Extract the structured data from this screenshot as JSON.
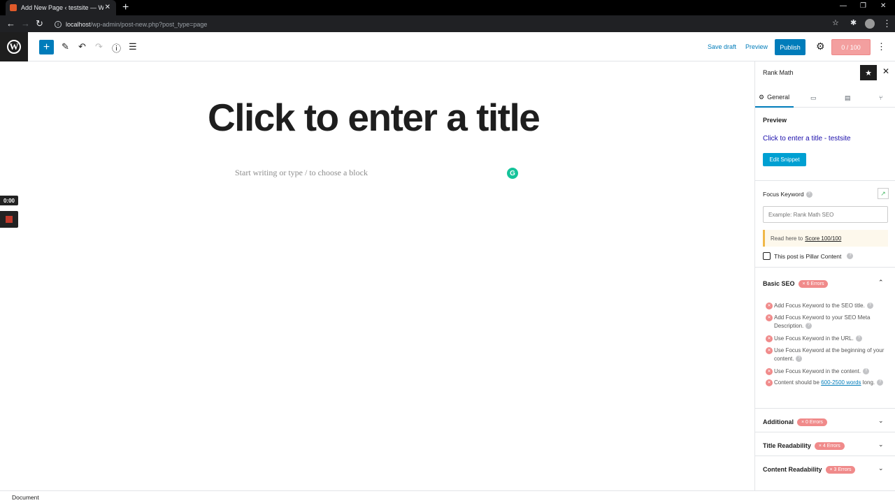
{
  "browser": {
    "tab_title": "Add New Page ‹ testsite — WordP",
    "url_host": "localhost",
    "url_path": "/wp-admin/post-new.php?post_type=page"
  },
  "header": {
    "save_draft": "Save draft",
    "preview": "Preview",
    "publish": "Publish",
    "score": "0 / 100"
  },
  "editor": {
    "title_placeholder": "Click to enter a title",
    "block_placeholder": "Start writing or type / to choose a block",
    "timer": "0:00"
  },
  "sidebar": {
    "title": "Rank Math",
    "tab_general": "General",
    "preview_heading": "Preview",
    "snippet_title": "Click to enter a title - testsite",
    "edit_snippet": "Edit Snippet",
    "focus_keyword_label": "Focus Keyword",
    "focus_keyword_placeholder": "Example: Rank Math SEO",
    "read_here": "Read here to",
    "read_here_link": "Score 100/100",
    "pillar_label": "This post is Pillar Content",
    "basic_seo": "Basic SEO",
    "basic_seo_badge": "× 6 Errors",
    "checks": [
      "Add Focus Keyword to the SEO title.",
      "Add Focus Keyword to your SEO Meta Description.",
      "Use Focus Keyword in the URL.",
      "Use Focus Keyword at the beginning of your content.",
      "Use Focus Keyword in the content."
    ],
    "check_last_pre": "Content should be",
    "check_last_link": "600-2500 words",
    "check_last_post": "long.",
    "additional": "Additional",
    "additional_badge": "× 0 Errors",
    "title_readability": "Title Readability",
    "title_readability_badge": "× 4 Errors",
    "content_readability": "Content Readability",
    "content_readability_badge": "× 3 Errors"
  },
  "statusbar": {
    "label": "Document"
  },
  "colors": {
    "accent": "#007cba",
    "error": "#f08a8a",
    "grammarly": "#15c39a"
  }
}
